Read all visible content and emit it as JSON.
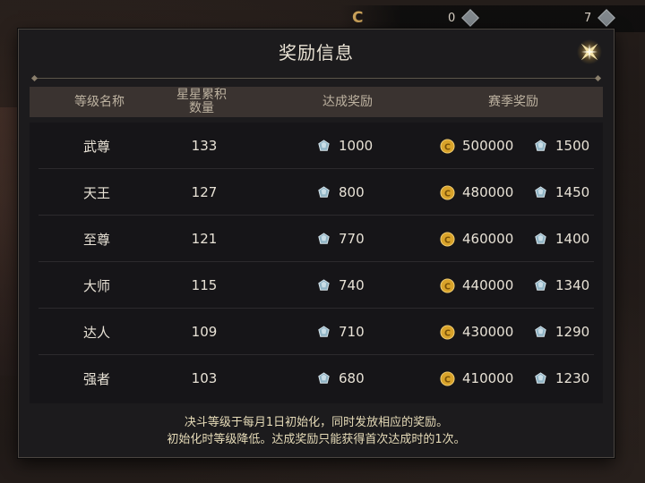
{
  "topbar": {
    "value_1": "0",
    "value_2": "7"
  },
  "dialog": {
    "title": "奖励信息",
    "columns": {
      "rank_name": "等级名称",
      "stars": "星星累积\n数量",
      "achievement_reward": "达成奖励",
      "season_reward": "赛季奖励"
    },
    "rows": [
      {
        "name": "武尊",
        "stars": "133",
        "achievement_gems": "1000",
        "season_gold": "500000",
        "season_gems": "1500"
      },
      {
        "name": "天王",
        "stars": "127",
        "achievement_gems": "800",
        "season_gold": "480000",
        "season_gems": "1450"
      },
      {
        "name": "至尊",
        "stars": "121",
        "achievement_gems": "770",
        "season_gold": "460000",
        "season_gems": "1400"
      },
      {
        "name": "大师",
        "stars": "115",
        "achievement_gems": "740",
        "season_gold": "440000",
        "season_gems": "1340"
      },
      {
        "name": "达人",
        "stars": "109",
        "achievement_gems": "710",
        "season_gold": "430000",
        "season_gems": "1290"
      },
      {
        "name": "强者",
        "stars": "103",
        "achievement_gems": "680",
        "season_gold": "410000",
        "season_gems": "1230"
      }
    ],
    "footer_line_1": "决斗等级于每月1日初始化，同时发放相应的奖励。",
    "footer_line_2": "初始化时等级降低。达成奖励只能获得首次达成时的1次。"
  },
  "icons": {
    "gem": "gem-icon",
    "coin": "gold-coin-icon",
    "close": "close-star-icon"
  },
  "colors": {
    "panel_bg": "#1c1b1d",
    "header_bg": "#3a3330",
    "coin": "#d9a32a",
    "gem": "#9fb7c2",
    "footer_text": "#e6dbb8"
  }
}
